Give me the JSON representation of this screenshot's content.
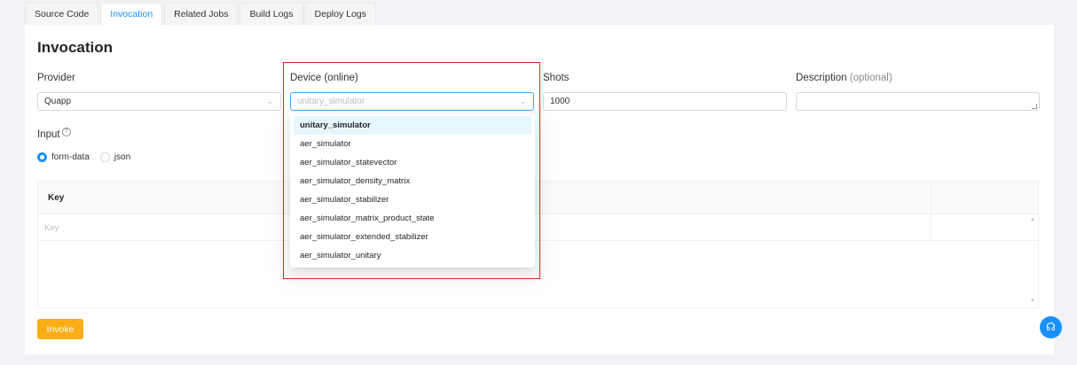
{
  "tabs": [
    {
      "label": "Source Code",
      "active": false
    },
    {
      "label": "Invocation",
      "active": true
    },
    {
      "label": "Related Jobs",
      "active": false
    },
    {
      "label": "Build Logs",
      "active": false
    },
    {
      "label": "Deploy Logs",
      "active": false
    }
  ],
  "page": {
    "title": "Invocation"
  },
  "provider": {
    "label": "Provider",
    "value": "Quapp"
  },
  "device": {
    "label": "Device (online)",
    "placeholder": "unitary_simulator",
    "options": [
      "unitary_simulator",
      "aer_simulator",
      "aer_simulator_statevector",
      "aer_simulator_density_matrix",
      "aer_simulator_stabilizer",
      "aer_simulator_matrix_product_state",
      "aer_simulator_extended_stabilizer",
      "aer_simulator_unitary"
    ],
    "selected_index": 0
  },
  "shots": {
    "label": "Shots",
    "value": "1000"
  },
  "description": {
    "label": "Description",
    "optional": "(optional)",
    "value": ""
  },
  "input": {
    "label": "Input",
    "help_icon": "question-circle-icon",
    "options": [
      {
        "label": "form-data",
        "checked": true
      },
      {
        "label": "json",
        "checked": false
      }
    ]
  },
  "table": {
    "header_key": "Key",
    "key_placeholder": "Key"
  },
  "invoke_button": {
    "label": "Invoke"
  },
  "support_icon": "headset-icon",
  "colors": {
    "primary": "#1890ff",
    "invoke": "#faad14",
    "highlight": "#e02020"
  }
}
